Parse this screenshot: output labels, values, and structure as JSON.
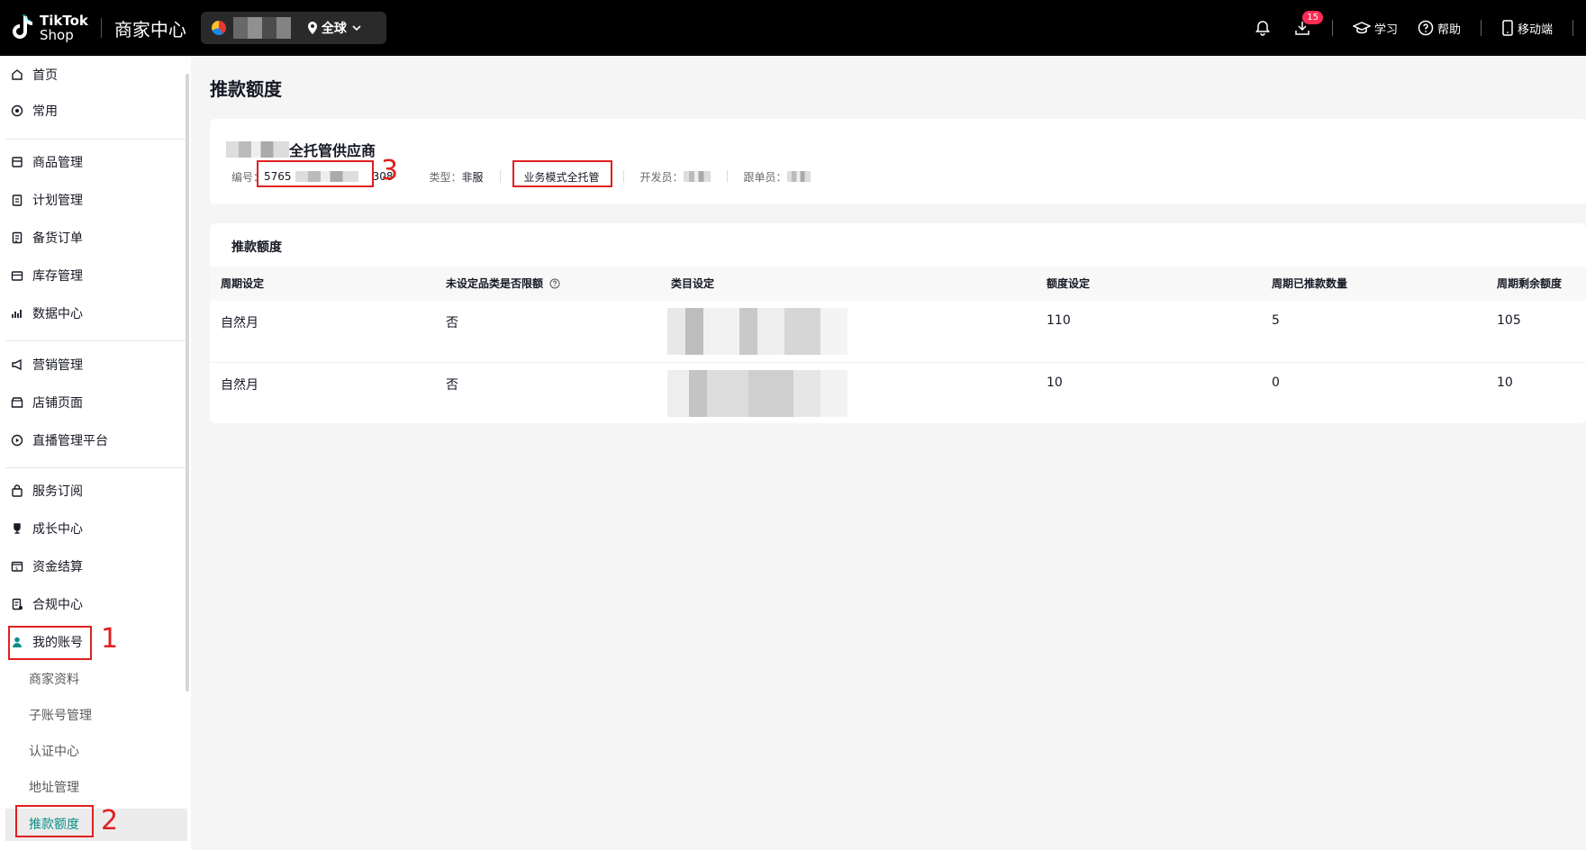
{
  "topbar": {
    "logo_line1": "TikTok",
    "logo_line2": "Shop",
    "app_title": "商家中心",
    "region": "全球",
    "download_badge": "15",
    "learn": "学习",
    "help": "帮助",
    "mobile": "移动端"
  },
  "sidebar": {
    "items": [
      {
        "label": "首页",
        "icon": "home-icon"
      },
      {
        "label": "常用",
        "icon": "star-icon"
      },
      {
        "label": "商品管理",
        "icon": "product-icon"
      },
      {
        "label": "计划管理",
        "icon": "clipboard-icon"
      },
      {
        "label": "备货订单",
        "icon": "order-icon"
      },
      {
        "label": "库存管理",
        "icon": "warehouse-icon"
      },
      {
        "label": "数据中心",
        "icon": "chart-icon"
      },
      {
        "label": "营销管理",
        "icon": "megaphone-icon"
      },
      {
        "label": "店铺页面",
        "icon": "store-icon"
      },
      {
        "label": "直播管理平台",
        "icon": "play-icon"
      },
      {
        "label": "服务订阅",
        "icon": "bag-icon"
      },
      {
        "label": "成长中心",
        "icon": "trophy-icon"
      },
      {
        "label": "资金结算",
        "icon": "money-icon"
      },
      {
        "label": "合规中心",
        "icon": "compliance-icon"
      },
      {
        "label": "我的账号",
        "icon": "user-icon"
      }
    ],
    "sub_items": [
      "商家资料",
      "子账号管理",
      "认证中心",
      "地址管理",
      "推款额度"
    ]
  },
  "annotations": [
    "1",
    "2",
    "3"
  ],
  "page": {
    "title": "推款额度",
    "supplier_suffix": "全托管供应商",
    "id_label": "编号：",
    "id_prefix": "5765",
    "id_suffix": "308",
    "type_label": "类型：",
    "type_value": "非服",
    "mode": "业务模式全托管",
    "developer_label": "开发员：",
    "follower_label": "跟单员："
  },
  "quota": {
    "title": "推款额度",
    "columns": [
      "周期设定",
      "未设定品类是否限额",
      "类目设定",
      "额度设定",
      "周期已推款数量",
      "周期剩余额度"
    ],
    "rows": [
      {
        "period": "自然月",
        "limit": "否",
        "quota": "110",
        "used": "5",
        "remaining": "105"
      },
      {
        "period": "自然月",
        "limit": "否",
        "quota": "10",
        "used": "0",
        "remaining": "10"
      }
    ]
  },
  "colors": {
    "accent": "#0b8e87",
    "annotation": "#e02020",
    "badge": "#fe2c55"
  }
}
